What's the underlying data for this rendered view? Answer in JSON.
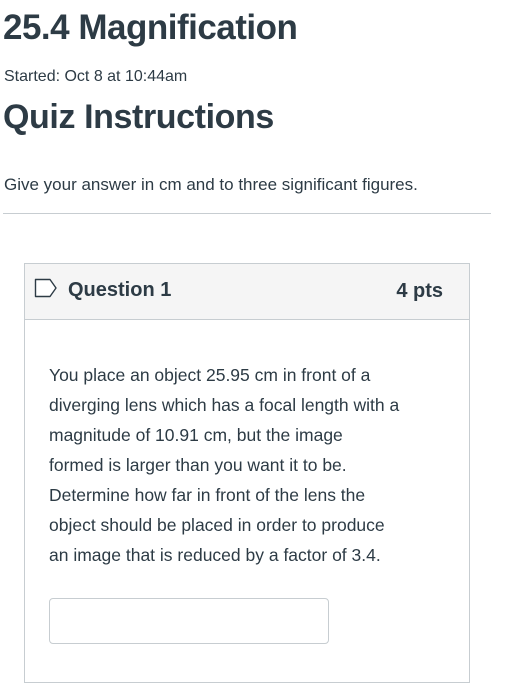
{
  "page": {
    "title": "25.4 Magnification",
    "started": "Started: Oct 8 at 10:44am"
  },
  "instructions": {
    "heading": "Quiz Instructions",
    "text": "Give your answer in cm and to three significant figures."
  },
  "question": {
    "name": "Question 1",
    "points": "4 pts",
    "text_lines": [
      "You place an object 25.95 cm in front of a",
      "diverging lens which has a focal length with a",
      "magnitude of 10.91 cm, but the image",
      "formed is larger than you want it to be.",
      "Determine how far in front of the lens the",
      "object should be placed in order to produce",
      "an image that is reduced by a factor of 3.4."
    ],
    "answer_value": "",
    "flag_icon": "bookmark-flag-icon"
  },
  "colors": {
    "text": "#2d3b45",
    "border": "#c7cdd1",
    "header_bg": "#f5f5f5"
  }
}
